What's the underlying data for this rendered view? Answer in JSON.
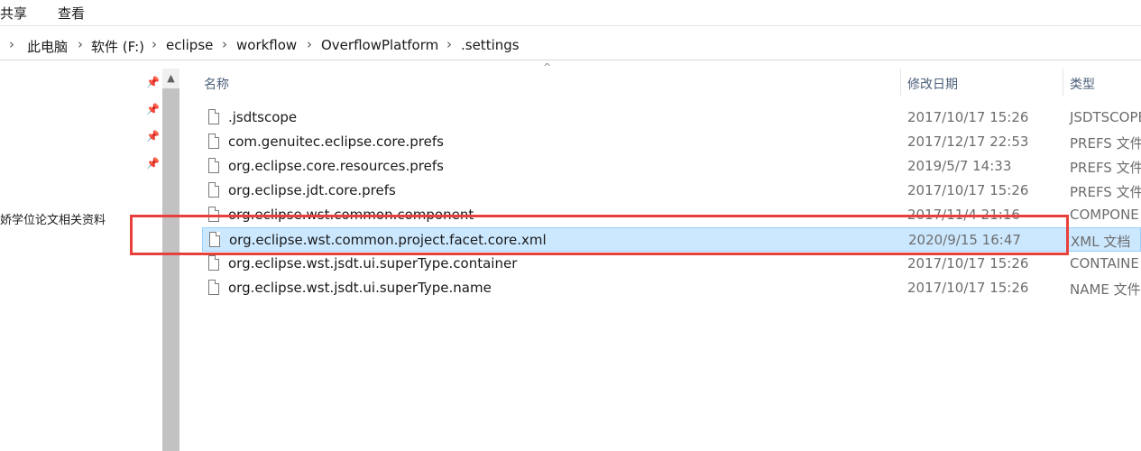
{
  "ribbon": {
    "tabs": [
      "共享",
      "查看"
    ]
  },
  "address": {
    "crumbs": [
      "此电脑",
      "软件 (F:)",
      "eclipse",
      "workflow",
      "OverflowPlatform",
      ".settings"
    ]
  },
  "nav": {
    "partial_label": "娇学位论文相关资料",
    "pin_count": 4
  },
  "columns": {
    "name": "名称",
    "date": "修改日期",
    "type": "类型"
  },
  "files": [
    {
      "name": ".jsdtscope",
      "date": "2017/10/17 15:26",
      "type": "JSDTSCOPE"
    },
    {
      "name": "com.genuitec.eclipse.core.prefs",
      "date": "2017/12/17 22:53",
      "type": "PREFS 文件"
    },
    {
      "name": "org.eclipse.core.resources.prefs",
      "date": "2019/5/7 14:33",
      "type": "PREFS 文件"
    },
    {
      "name": "org.eclipse.jdt.core.prefs",
      "date": "2017/10/17 15:26",
      "type": "PREFS 文件"
    },
    {
      "name": "org.eclipse.wst.common.component",
      "date": "2017/11/4 21:16",
      "type": "COMPONE"
    },
    {
      "name": "org.eclipse.wst.common.project.facet.core.xml",
      "date": "2020/9/15 16:47",
      "type": "XML 文档",
      "selected": true
    },
    {
      "name": "org.eclipse.wst.jsdt.ui.superType.container",
      "date": "2017/10/17 15:26",
      "type": "CONTAINE"
    },
    {
      "name": "org.eclipse.wst.jsdt.ui.superType.name",
      "date": "2017/10/17 15:26",
      "type": "NAME 文件"
    }
  ],
  "colors": {
    "selection_bg": "#cce8ff",
    "selection_border": "#99d1ff",
    "annotation_red": "#e8413c",
    "header_text": "#4c607a"
  }
}
